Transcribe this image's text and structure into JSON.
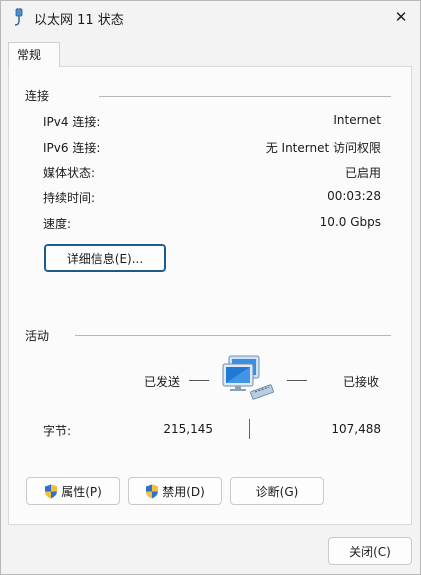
{
  "window": {
    "title": "以太网 11 状态",
    "close_glyph": "✕"
  },
  "tabs": [
    {
      "label": "常规"
    }
  ],
  "connection": {
    "title": "连接",
    "rows": [
      {
        "label": "IPv4 连接:",
        "value": "Internet"
      },
      {
        "label": "IPv6 连接:",
        "value": "无 Internet 访问权限"
      },
      {
        "label": "媒体状态:",
        "value": "已启用"
      },
      {
        "label": "持续时间:",
        "value": "00:03:28"
      },
      {
        "label": "速度:",
        "value": "10.0 Gbps"
      }
    ],
    "details_button": "详细信息(E)..."
  },
  "activity": {
    "title": "活动",
    "sent_label": "已发送",
    "received_label": "已接收",
    "bytes_label": "字节:",
    "bytes_sent": "215,145",
    "bytes_received": "107,488"
  },
  "buttons": {
    "properties": "属性(P)",
    "disable": "禁用(D)",
    "diagnose": "诊断(G)",
    "close": "关闭(C)"
  },
  "icons": {
    "title": "network-plug-icon",
    "activity": "network-computers-icon",
    "shield": "uac-shield-icon"
  }
}
